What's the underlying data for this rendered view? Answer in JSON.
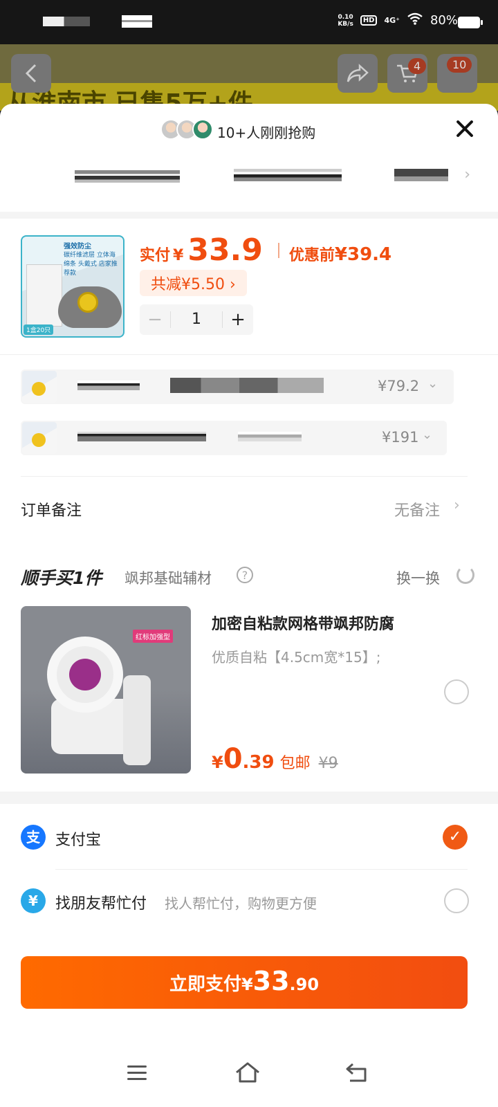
{
  "status_bar": {
    "net_speed_value": "0.10",
    "net_speed_unit": "KB/s",
    "hd": "HD",
    "signal": "4G⁺",
    "battery": "80%"
  },
  "background": {
    "title": "从淮南市 已售5万+件",
    "cart_badge": "4",
    "msg_badge": "10"
  },
  "sheet": {
    "buyers_text": "10+人刚刚抢购",
    "product": {
      "pay_label": "实付",
      "currency": "¥",
      "pay_amount": "33.9",
      "orig_label": "优惠前",
      "orig_price": "¥39.4",
      "discount_text": "共减¥5.50 ›",
      "thumb_title": "强效防尘",
      "thumb_lines": "碳纤维滤层 立体海绵条 头戴式 店家推荐款",
      "thumb_foot": "1盒20只",
      "qty_minus": "−",
      "quantity": "1",
      "qty_plus": "+"
    },
    "variants": [
      {
        "price": "¥79.2"
      },
      {
        "price": "¥191"
      }
    ],
    "order_note": {
      "label": "订单备注",
      "value": "无备注"
    },
    "addon": {
      "title": "顺手买1件",
      "subtitle": "飒邦基础辅材",
      "help": "?",
      "swap": "换一换",
      "tag": "红标加强型",
      "name": "加密自粘款网格带飒邦防腐",
      "desc": "优质自粘【4.5cm宽*15】;",
      "price_yen": "¥",
      "price_int": "0",
      "price_dec": ".39",
      "shipping": "包邮",
      "orig_price": "¥9"
    },
    "payment": {
      "alipay_label": "支付宝",
      "alipay_glyph": "支",
      "friend_label": "找朋友帮忙付",
      "friend_sub": "找人帮忙付，购物更方便",
      "friend_glyph": "¥",
      "check": "✓"
    },
    "pay_button": {
      "text": "立即支付",
      "yen": "¥",
      "amount_int": "33",
      "amount_dec": ".90"
    }
  },
  "icons": {
    "close": "close-icon",
    "chevron": "›",
    "chevron_down": "⌄"
  },
  "colors": {
    "accent": "#f04d0f",
    "alipay": "#1677ff"
  }
}
